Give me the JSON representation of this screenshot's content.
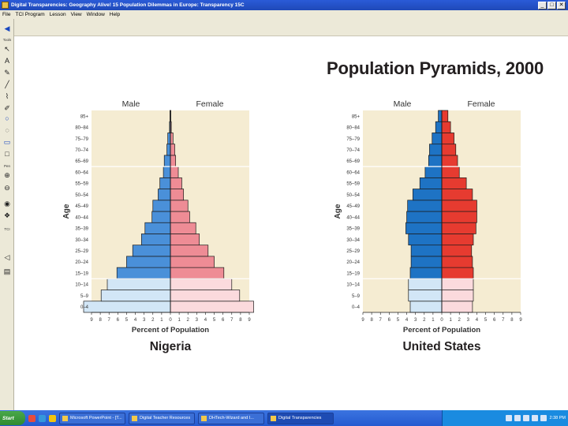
{
  "window": {
    "title": "Digital Transparencies: Geography Alive! 15 Population Dilemmas in Europe: Transparency 15C",
    "buttons": {
      "minimize": "_",
      "maximize": "□",
      "close": "✕"
    }
  },
  "menu": [
    "File",
    "TCI Program",
    "Lesson",
    "View",
    "Window",
    "Help"
  ],
  "palette": {
    "labels": {
      "tools": "Tools",
      "tcipen": "Pen",
      "tcitext": "TCI"
    }
  },
  "page_title": "Population Pyramids, 2000",
  "charts": {
    "colors": {
      "background": "#f5ecd2",
      "male_dark": "#4a90d9",
      "male_light": "#d2e6f6",
      "female_dark": "#ee8c95",
      "female_light": "#fbdadd",
      "male_dark_us": "#1e73c4",
      "female_dark_us": "#e63b30"
    }
  },
  "chart_data": [
    {
      "type": "bar",
      "title": "Nigeria",
      "xlabel": "Percent of Population",
      "ylabel": "Age",
      "male_label": "Male",
      "female_label": "Female",
      "categories": [
        "0–4",
        "5–9",
        "10–14",
        "15–19",
        "20–24",
        "25–29",
        "30–34",
        "35–39",
        "40–44",
        "45–49",
        "50–54",
        "55–59",
        "60–64",
        "65–69",
        "70–74",
        "75–79",
        "80–84",
        "85+"
      ],
      "series": [
        {
          "name": "Male",
          "values": [
            9.9,
            7.9,
            7.2,
            6.1,
            5.0,
            4.3,
            3.3,
            2.9,
            2.1,
            2.0,
            1.4,
            1.2,
            0.8,
            0.7,
            0.4,
            0.3,
            0.1,
            0.05
          ]
        },
        {
          "name": "Female",
          "values": [
            9.5,
            7.9,
            7.0,
            6.1,
            5.0,
            4.3,
            3.3,
            2.9,
            2.2,
            2.0,
            1.5,
            1.3,
            0.9,
            0.6,
            0.5,
            0.3,
            0.1,
            0.05
          ]
        }
      ],
      "x_ticks": [
        "9",
        "8",
        "7",
        "6",
        "5",
        "4",
        "3",
        "2",
        "1",
        "0",
        "1",
        "2",
        "3",
        "4",
        "5",
        "6",
        "7",
        "8",
        "9"
      ],
      "xlim": [
        -9,
        9
      ]
    },
    {
      "type": "bar",
      "title": "United States",
      "xlabel": "Percent of Population",
      "ylabel": "Age",
      "male_label": "Male",
      "female_label": "Female",
      "categories": [
        "0–4",
        "5–9",
        "10–14",
        "15–19",
        "20–24",
        "25–29",
        "30–34",
        "35–39",
        "40–44",
        "45–49",
        "50–54",
        "55–59",
        "60–64",
        "65–69",
        "70–74",
        "75–79",
        "80–84",
        "85+"
      ],
      "series": [
        {
          "name": "Male",
          "values": [
            3.6,
            3.8,
            3.8,
            3.6,
            3.5,
            3.5,
            3.8,
            4.1,
            4.0,
            3.9,
            3.3,
            2.5,
            1.9,
            1.5,
            1.4,
            1.1,
            0.7,
            0.4
          ]
        },
        {
          "name": "Female",
          "values": [
            3.5,
            3.6,
            3.6,
            3.6,
            3.5,
            3.4,
            3.6,
            3.9,
            4.0,
            4.0,
            3.5,
            2.8,
            2.0,
            1.8,
            1.6,
            1.4,
            1.0,
            0.7
          ]
        }
      ],
      "x_ticks": [
        "9",
        "8",
        "7",
        "6",
        "5",
        "4",
        "3",
        "2",
        "1",
        "0",
        "1",
        "2",
        "3",
        "4",
        "5",
        "6",
        "7",
        "8",
        "9"
      ],
      "xlim": [
        -9,
        9
      ]
    }
  ],
  "taskbar": {
    "start": "Start",
    "tasks": [
      {
        "label": "Microsoft PowerPoint - [T...",
        "active": false
      },
      {
        "label": "Digital Teacher Resources",
        "active": false
      },
      {
        "label": "DHTech-Wizard and I...",
        "active": false
      },
      {
        "label": "Digital Transparencies",
        "active": true
      }
    ],
    "clock": "2:38 PM"
  }
}
